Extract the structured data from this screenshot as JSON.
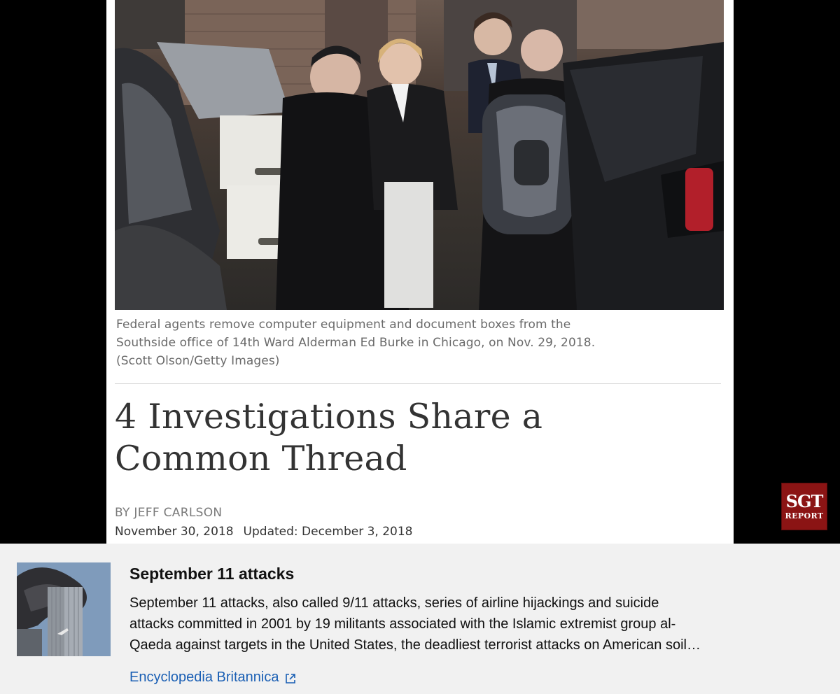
{
  "article": {
    "caption_lines": [
      "Federal agents remove computer equipment and document boxes from the",
      "Southside office of 14th Ward Alderman Ed Burke in Chicago, on Nov. 29, 2018.",
      "(Scott Olson/Getty Images)"
    ],
    "headline_lines": [
      "4 Investigations Share a",
      "Common Thread"
    ],
    "byline": "BY JEFF CARLSON",
    "date": "November 30, 2018",
    "updated": "Updated: December 3, 2018"
  },
  "watermark": {
    "top": "SGT",
    "bottom": "REPORT"
  },
  "info_panel": {
    "title": "September 11 attacks",
    "description_lines": [
      "September 11 attacks, also called 9/11 attacks, series of airline hijackings and suicide",
      "attacks committed in 2001 by 19 militants associated with the Islamic extremist group al-",
      "Qaeda against targets in the United States, the deadliest terrorist attacks on American soil…"
    ],
    "source_link": "Encyclopedia Britannica",
    "link_icon": "external-link-icon"
  },
  "colors": {
    "panel_bg": "#f1f1f1",
    "link": "#1a5fb4",
    "watermark_bg": "#8b1414"
  }
}
